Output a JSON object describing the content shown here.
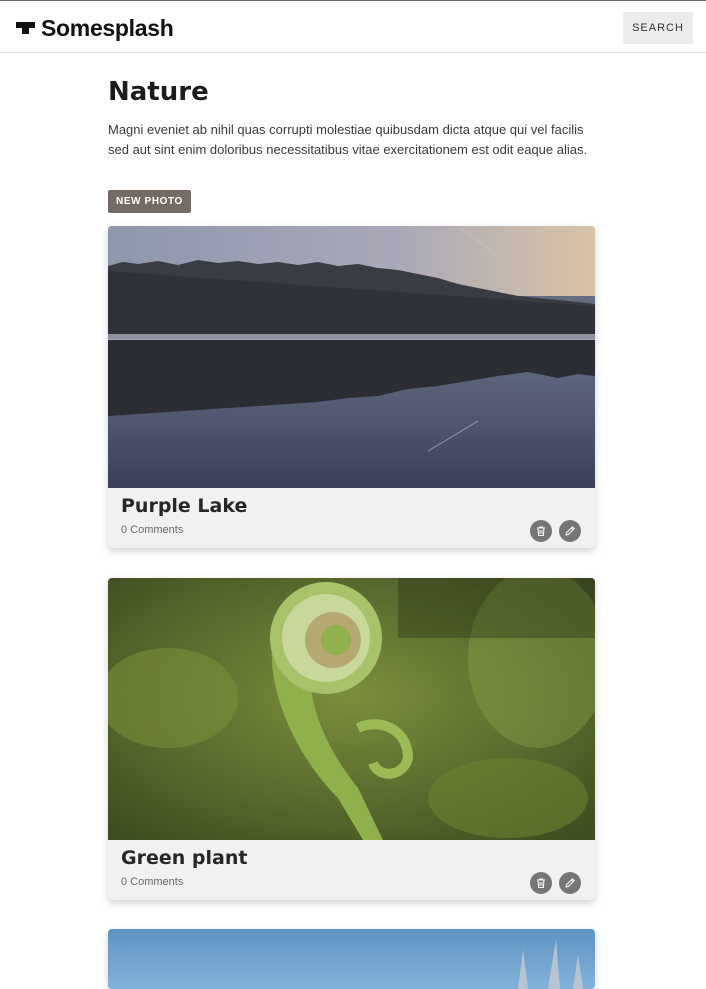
{
  "header": {
    "logo_text": "Somesplash",
    "search_label": "SEARCH"
  },
  "main": {
    "title": "Nature",
    "description": "Magni eveniet ab nihil quas corrupti molestiae quibusdam dicta atque qui vel facilis sed aut sint enim doloribus necessitatibus vitae exercitationem est odit eaque alias.",
    "new_photo_label": "NEW PHOTO"
  },
  "photos": [
    {
      "title": "Purple Lake",
      "comments": "0 Comments"
    },
    {
      "title": "Green plant",
      "comments": "0 Comments"
    }
  ],
  "colors": {
    "new_photo_button": "#756b66",
    "icon_button": "#767676",
    "card_body": "#f1f1f1"
  }
}
